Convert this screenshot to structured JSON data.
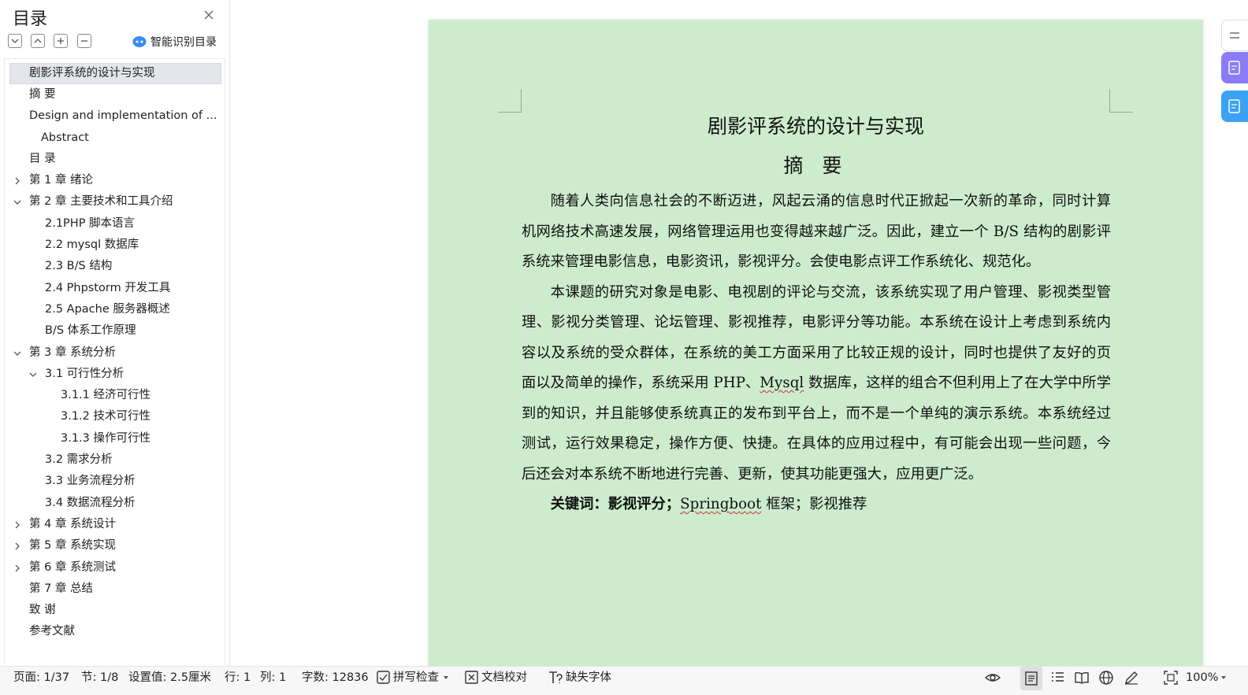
{
  "sidebar": {
    "title": "目录",
    "smart_toc_label": "智能识别目录",
    "toc": [
      {
        "label": "剧影评系统的设计与实现",
        "level": 1,
        "arrow": "none",
        "selected": true
      },
      {
        "label": "摘  要",
        "level": 1,
        "arrow": "none"
      },
      {
        "label": "Design and implementation of ...",
        "level": 1,
        "arrow": "none"
      },
      {
        "label": "Abstract",
        "level": 1.5,
        "arrow": "none"
      },
      {
        "label": "目   录",
        "level": 1,
        "arrow": "none"
      },
      {
        "label": "第 1 章  绪论",
        "level": 1,
        "arrow": "right"
      },
      {
        "label": "第 2 章  主要技术和工具介绍",
        "level": 1,
        "arrow": "down"
      },
      {
        "label": "2.1PHP 脚本语言",
        "level": 2,
        "arrow": "none"
      },
      {
        "label": "2.2 mysql 数据库",
        "level": 2,
        "arrow": "none"
      },
      {
        "label": "2.3 B/S 结构",
        "level": 2,
        "arrow": "none"
      },
      {
        "label": "2.4 Phpstorm 开发工具",
        "level": 2,
        "arrow": "none"
      },
      {
        "label": "2.5 Apache 服务器概述",
        "level": 2,
        "arrow": "none"
      },
      {
        "label": "B/S 体系工作原理",
        "level": 2,
        "arrow": "none"
      },
      {
        "label": "第 3 章  系统分析",
        "level": 1,
        "arrow": "down"
      },
      {
        "label": "3.1 可行性分析",
        "level": 2,
        "arrow": "down"
      },
      {
        "label": "3.1.1 经济可行性",
        "level": 3,
        "arrow": "none"
      },
      {
        "label": "3.1.2 技术可行性",
        "level": 3,
        "arrow": "none"
      },
      {
        "label": "3.1.3 操作可行性",
        "level": 3,
        "arrow": "none"
      },
      {
        "label": "3.2 需求分析",
        "level": 2,
        "arrow": "none"
      },
      {
        "label": "3.3 业务流程分析",
        "level": 2,
        "arrow": "none"
      },
      {
        "label": "3.4 数据流程分析",
        "level": 2,
        "arrow": "none"
      },
      {
        "label": "第 4 章  系统设计",
        "level": 1,
        "arrow": "right"
      },
      {
        "label": "第 5 章    系统实现",
        "level": 1,
        "arrow": "right"
      },
      {
        "label": "第 6 章    系统测试",
        "level": 1,
        "arrow": "right"
      },
      {
        "label": "第 7 章    总结",
        "level": 1,
        "arrow": "none"
      },
      {
        "label": "致   谢",
        "level": 1,
        "arrow": "none"
      },
      {
        "label": "参考文献",
        "level": 1,
        "arrow": "none"
      }
    ]
  },
  "document": {
    "title": "剧影评系统的设计与实现",
    "abstract_title": "摘 要",
    "paragraph1": "随着人类向信息社会的不断迈进，风起云涌的信息时代正掀起一次新的革命，同时计算机网络技术高速发展，网络管理运用也变得越来越广泛。因此，建立一个 B/S 结构的剧影评系统来管理电影信息，电影资讯，影视评分。会使电影点评工作系统化、规范化。",
    "paragraph2_a": "本课题的研究对象是电影、电视剧的评论与交流，该系统实现了用户管理、影视类型管理、影视分类管理、论坛管理、影视推荐，电影评分等功能。本系统在设计上考虑到系统内容以及系统的受众群体，在系统的美工方面采用了比较正规的设计，同时也提供了友好的页面以及简单的操作，系统采用 PHP、",
    "paragraph2_mysql": "Mysql",
    "paragraph2_b": " 数据库，这样的组合不但利用上了在大学中所学到的知识，并且能够使系统真正的发布到平台上，而不是一个单纯的演示系统。本系统经过测试，运行效果稳定，操作方便、快捷。在具体的应用过程中，有可能会出现一些问题，今后还会对本系统不断地进行完善、更新，使其功能更强大，应用更广泛。",
    "keywords_label": "关键词：影视评分；",
    "keywords_springboot": "Springboot",
    "keywords_rest": " 框架；影视推荐"
  },
  "statusbar": {
    "page": "页面: 1/37",
    "section": "节: 1/8",
    "setting": "设置值: 2.5厘米",
    "row": "行: 1",
    "col": "列: 1",
    "wordcount": "字数: 12836",
    "spellcheck": "拼写检查",
    "doc_proof": "文档校对",
    "missing_font": "缺失字体",
    "zoom": "100%"
  },
  "colors": {
    "page_bg": "#cdeccd",
    "accent_purple": "#8b7cf6",
    "accent_blue": "#3ba1f5"
  }
}
